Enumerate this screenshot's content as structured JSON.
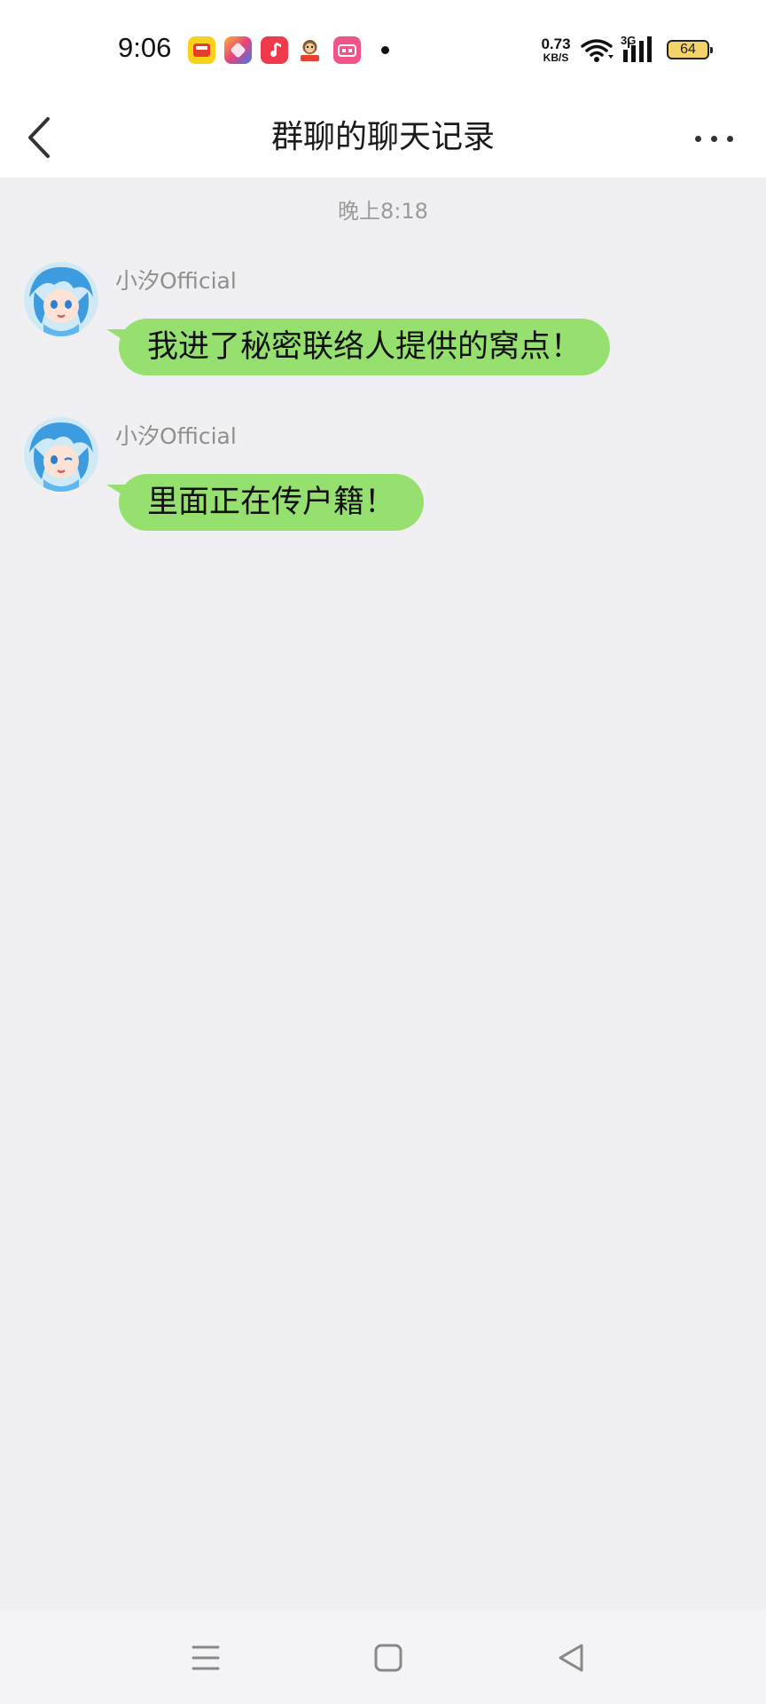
{
  "status_bar": {
    "time": "9:06",
    "net_speed_value": "0.73",
    "net_speed_unit": "KB/S",
    "network_type": "3G",
    "battery_level": "64",
    "notification_icons": [
      "app-icon-yellow",
      "app-icon-blue",
      "app-icon-music",
      "app-icon-monkey",
      "app-icon-pink"
    ]
  },
  "header": {
    "title": "群聊的聊天记录",
    "back_icon": "chevron-left-icon",
    "more_icon": "more-dots-icon"
  },
  "chat": {
    "timestamp": "晚上8:18",
    "messages": [
      {
        "sender": "小汐Official",
        "text": "我进了秘密联络人提供的窝点！"
      },
      {
        "sender": "小汐Official",
        "text": "里面正在传户籍！"
      }
    ]
  },
  "colors": {
    "bubble": "#95e06e",
    "background": "#f0f0f2"
  },
  "nav_bar": {
    "icons": [
      "menu-icon",
      "home-icon",
      "back-triangle-icon"
    ]
  }
}
